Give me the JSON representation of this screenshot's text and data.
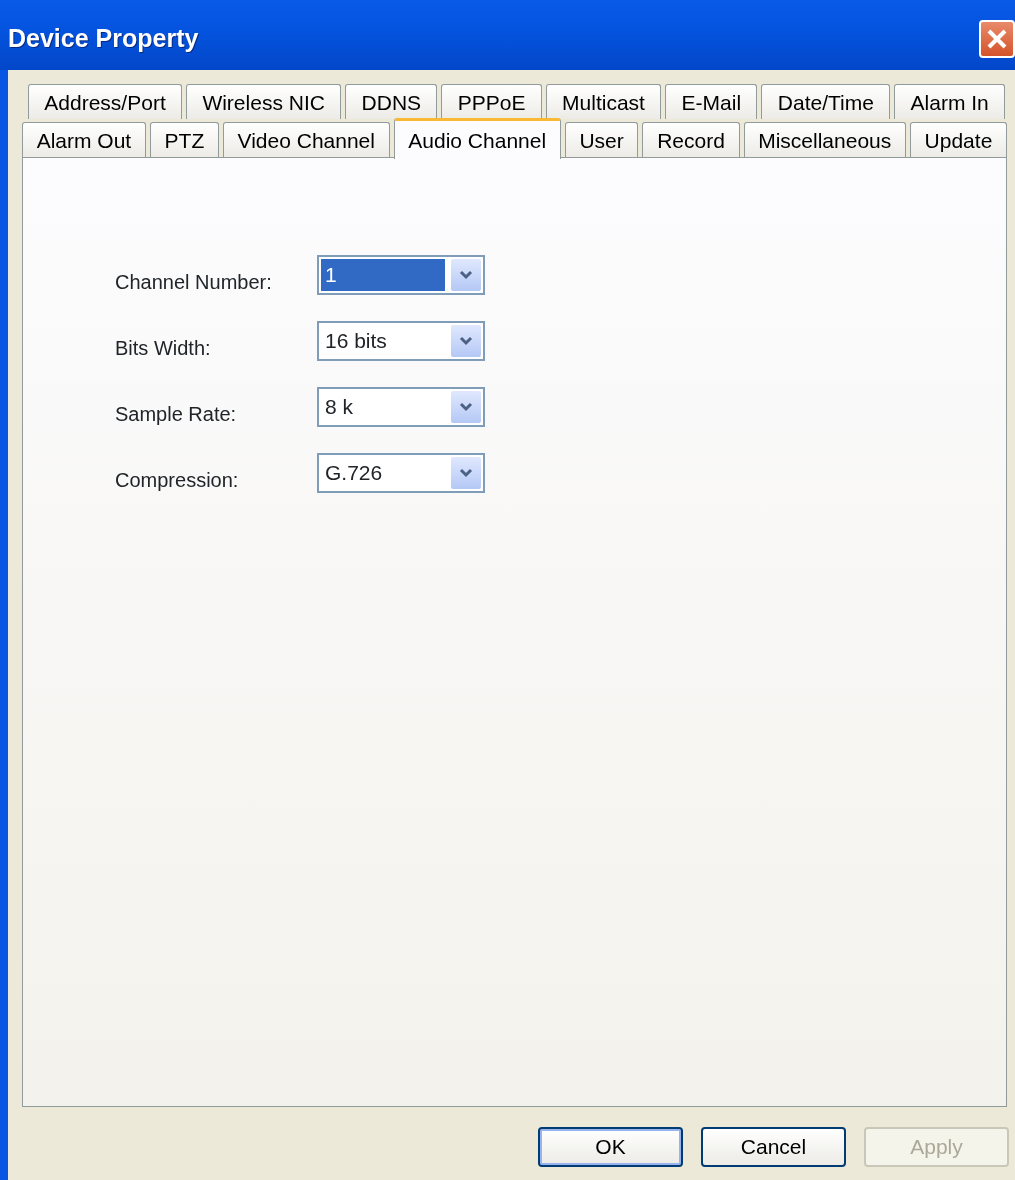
{
  "window": {
    "title": "Device Property"
  },
  "tab_rows": [
    [
      {
        "label": "Address/Port",
        "selected": false
      },
      {
        "label": "Wireless NIC",
        "selected": false
      },
      {
        "label": "DDNS",
        "selected": false
      },
      {
        "label": "PPPoE",
        "selected": false
      },
      {
        "label": "Multicast",
        "selected": false
      },
      {
        "label": "E-Mail",
        "selected": false
      },
      {
        "label": "Date/Time",
        "selected": false
      },
      {
        "label": "Alarm In",
        "selected": false
      }
    ],
    [
      {
        "label": "Alarm Out",
        "selected": false
      },
      {
        "label": "PTZ",
        "selected": false
      },
      {
        "label": "Video Channel",
        "selected": false
      },
      {
        "label": "Audio Channel",
        "selected": true
      },
      {
        "label": "User",
        "selected": false
      },
      {
        "label": "Record",
        "selected": false
      },
      {
        "label": "Miscellaneous",
        "selected": false
      },
      {
        "label": "Update",
        "selected": false
      }
    ]
  ],
  "fields": [
    {
      "label": "Channel Number:",
      "value": "1",
      "focused": true
    },
    {
      "label": "Bits Width:",
      "value": "16 bits",
      "focused": false
    },
    {
      "label": "Sample Rate:",
      "value": "8 k",
      "focused": false
    },
    {
      "label": "Compression:",
      "value": "G.726",
      "focused": false
    }
  ],
  "buttons": [
    {
      "label": "OK",
      "default": true,
      "disabled": false
    },
    {
      "label": "Cancel",
      "default": false,
      "disabled": false
    },
    {
      "label": "Apply",
      "default": false,
      "disabled": true
    }
  ]
}
